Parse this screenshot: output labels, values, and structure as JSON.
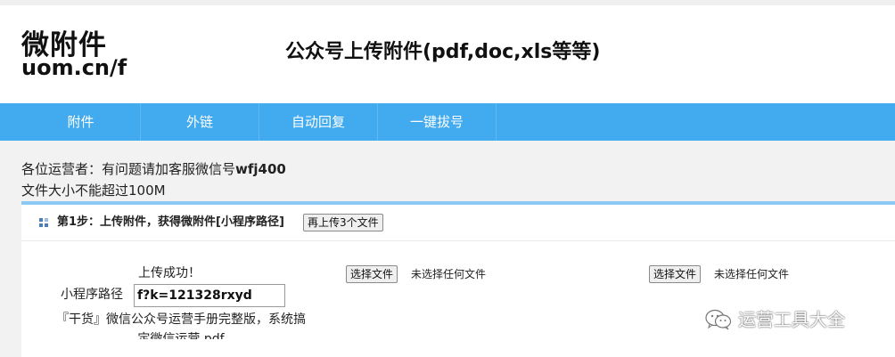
{
  "header": {
    "logo_main": "微附件",
    "logo_sub": "uom.cn/f",
    "title": "公众号上传附件(pdf,doc,xls等等)"
  },
  "nav": {
    "items": [
      {
        "label": "附件"
      },
      {
        "label": "外链"
      },
      {
        "label": "自动回复"
      },
      {
        "label": "一键拔号"
      }
    ]
  },
  "notice": {
    "prefix": "各位运营者：有问题请加客服微信号",
    "wechat_id": "wfj400",
    "size_limit": "文件大小不能超过100M"
  },
  "step": {
    "label": "第1步：上传附件，获得微附件[小程序路径]",
    "reupload_button": "再上传3个文件"
  },
  "upload_result": {
    "status": "上传成功！",
    "path_label": "小程序路径",
    "path_value": "f?k=121328rxyd",
    "file_name": "『干货』微信公众号运营手册完整版，系统搞定微信运营.pdf"
  },
  "file_slots": [
    {
      "button": "选择文件",
      "status": "未选择任何文件"
    },
    {
      "button": "选择文件",
      "status": "未选择任何文件"
    }
  ],
  "watermark": {
    "text": "运营工具大全",
    "icon": "wechat-icon"
  },
  "colors": {
    "nav_bg": "#42aaef",
    "accent_rule": "#8cc8f4",
    "content_bg": "#f2f2f2"
  }
}
